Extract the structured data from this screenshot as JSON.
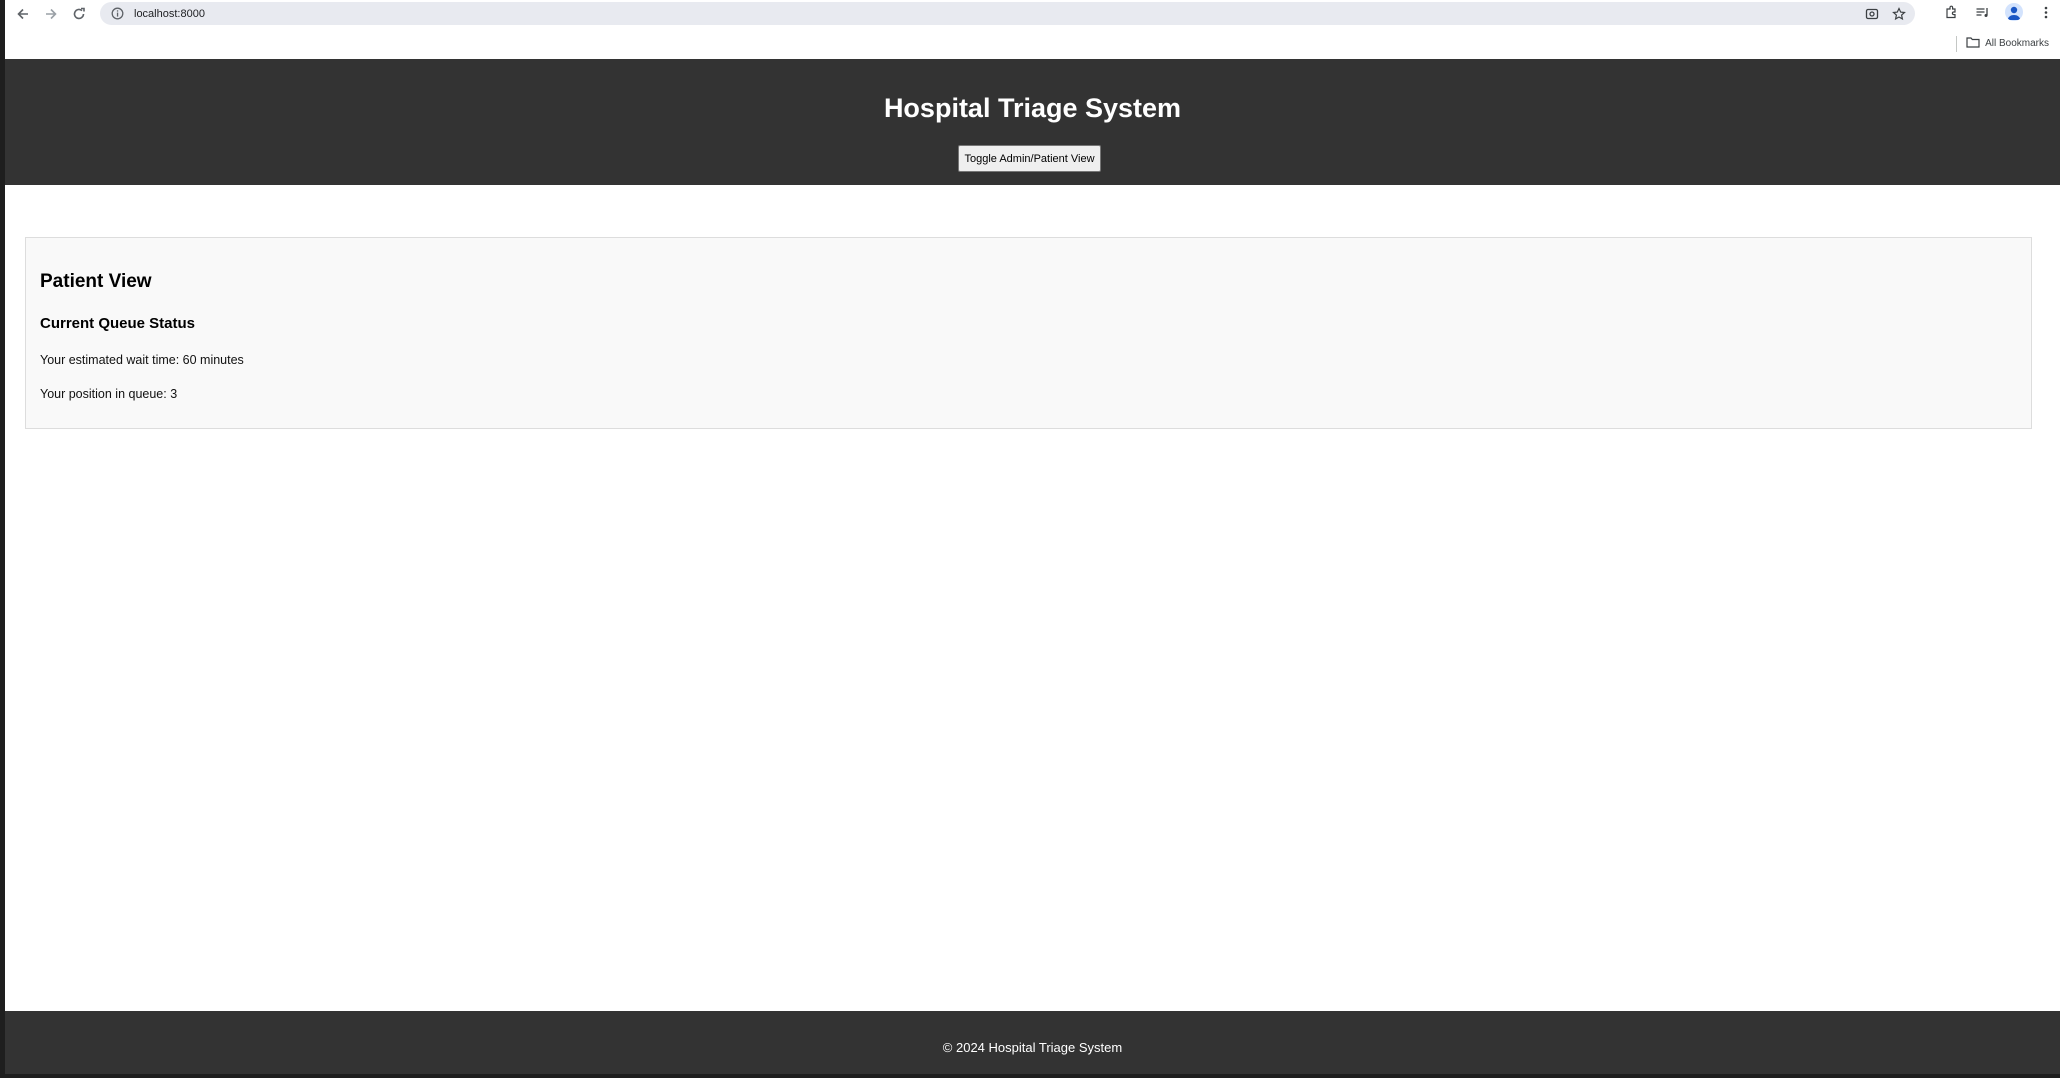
{
  "browser": {
    "url": "localhost:8000",
    "bookmarks_label": "All Bookmarks"
  },
  "header": {
    "title": "Hospital Triage System",
    "toggle_label": "Toggle Admin/Patient View"
  },
  "patient_view": {
    "title": "Patient View",
    "queue_heading": "Current Queue Status",
    "wait_text": "Your estimated wait time: 60 minutes",
    "position_text": "Your position in queue: 3"
  },
  "footer": {
    "text": "© 2024 Hospital Triage System"
  },
  "colors": {
    "header_bg": "#333333",
    "panel_bg": "#f9f9f9",
    "omnibox_bg": "#e8eaf0"
  }
}
